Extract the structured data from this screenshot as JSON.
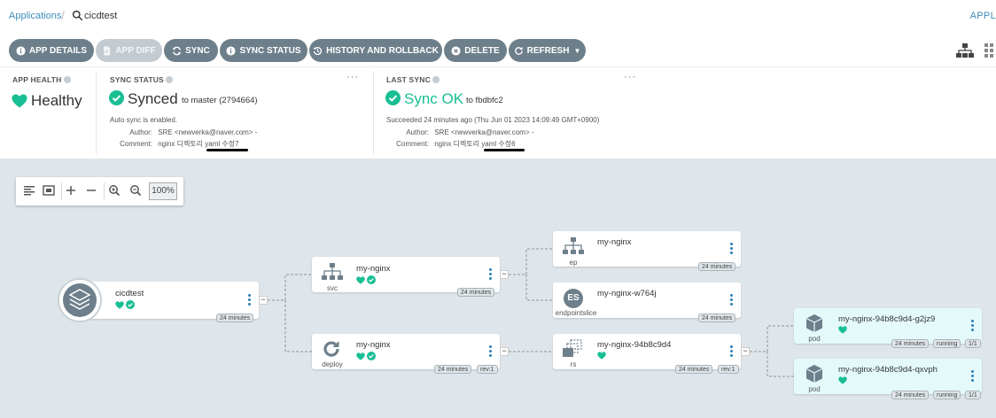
{
  "breadcrumb": {
    "root": "Applications",
    "current": "cicdtest",
    "right_label": "APPL"
  },
  "toolbar": {
    "app_details": "APP DETAILS",
    "app_diff": "APP DIFF",
    "sync": "SYNC",
    "sync_status": "SYNC STATUS",
    "history_rollback": "HISTORY AND ROLLBACK",
    "delete": "DELETE",
    "refresh": "REFRESH"
  },
  "app_health": {
    "label": "APP HEALTH",
    "value": "Healthy"
  },
  "sync_status": {
    "label": "SYNC STATUS",
    "value": "Synced",
    "target": "to master (2794664)",
    "auto_sync": "Auto sync is enabled.",
    "author_key": "Author:",
    "author": "SRE <newverka@naver.com> -",
    "comment_key": "Comment:",
    "comment": "nginx 디렉토리 yaml 수정7",
    "more": "···"
  },
  "last_sync": {
    "label": "LAST SYNC",
    "value": "Sync OK",
    "target": "to fbdbfc2",
    "succeeded": "Succeeded 24 minutes ago (Thu Jun 01 2023 14:09:49 GMT+0900)",
    "author_key": "Author:",
    "author": "SRE <newverka@naver.com> -",
    "comment_key": "Comment:",
    "comment": "nginx 디렉토리 yaml 수정6",
    "more": "···"
  },
  "zoom": {
    "value": "100%"
  },
  "graph": {
    "app": {
      "name": "cicdtest",
      "age": "24 minutes"
    },
    "svc": {
      "name": "my-nginx",
      "kind": "svc",
      "age": "24 minutes"
    },
    "deploy": {
      "name": "my-nginx",
      "kind": "deploy",
      "age": "24 minutes",
      "rev": "rev:1"
    },
    "ep": {
      "name": "my-nginx",
      "kind": "ep",
      "age": "24 minutes"
    },
    "endpointslice": {
      "name": "my-nginx-w764j",
      "kind": "endpointslice",
      "badge": "ES",
      "age": "24 minutes"
    },
    "rs": {
      "name": "my-nginx-94b8c9d4",
      "kind": "rs",
      "age": "24 minutes",
      "rev": "rev:1"
    },
    "pod1": {
      "name": "my-nginx-94b8c9d4-g2jz9",
      "kind": "pod",
      "age": "24 minutes",
      "status": "running",
      "ready": "1/1"
    },
    "pod2": {
      "name": "my-nginx-94b8c9d4-qxvph",
      "kind": "pod",
      "age": "24 minutes",
      "status": "running",
      "ready": "1/1"
    }
  },
  "colors": {
    "healthy": "#18be94",
    "button": "#6d7f8b",
    "canvas": "#dee6eb",
    "link": "#3e8eb9"
  }
}
